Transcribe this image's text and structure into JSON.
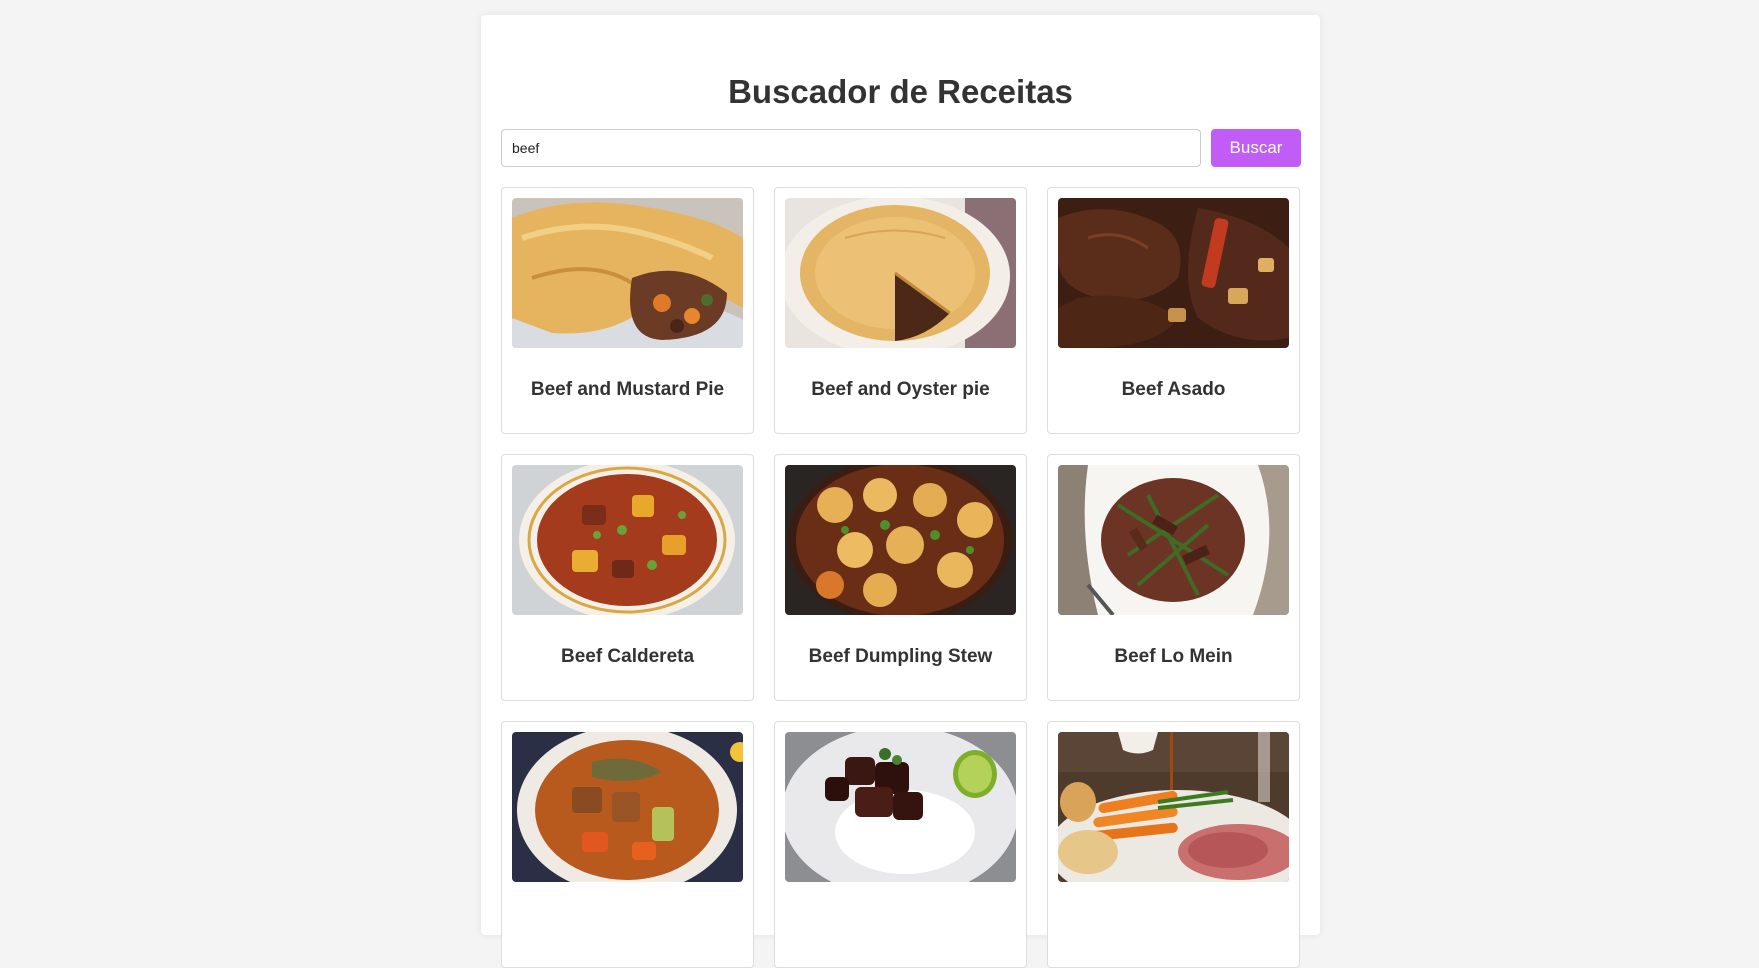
{
  "page": {
    "title": "Buscador de Receitas"
  },
  "search": {
    "value": "beef",
    "button_label": "Buscar"
  },
  "theme": {
    "accent": "#c25cf6",
    "background": "#f4f4f4"
  },
  "recipes": [
    {
      "title": "Beef and Mustard Pie"
    },
    {
      "title": "Beef and Oyster pie"
    },
    {
      "title": "Beef Asado"
    },
    {
      "title": "Beef Caldereta"
    },
    {
      "title": "Beef Dumpling Stew"
    },
    {
      "title": "Beef Lo Mein"
    },
    {
      "title": ""
    },
    {
      "title": ""
    },
    {
      "title": ""
    }
  ]
}
